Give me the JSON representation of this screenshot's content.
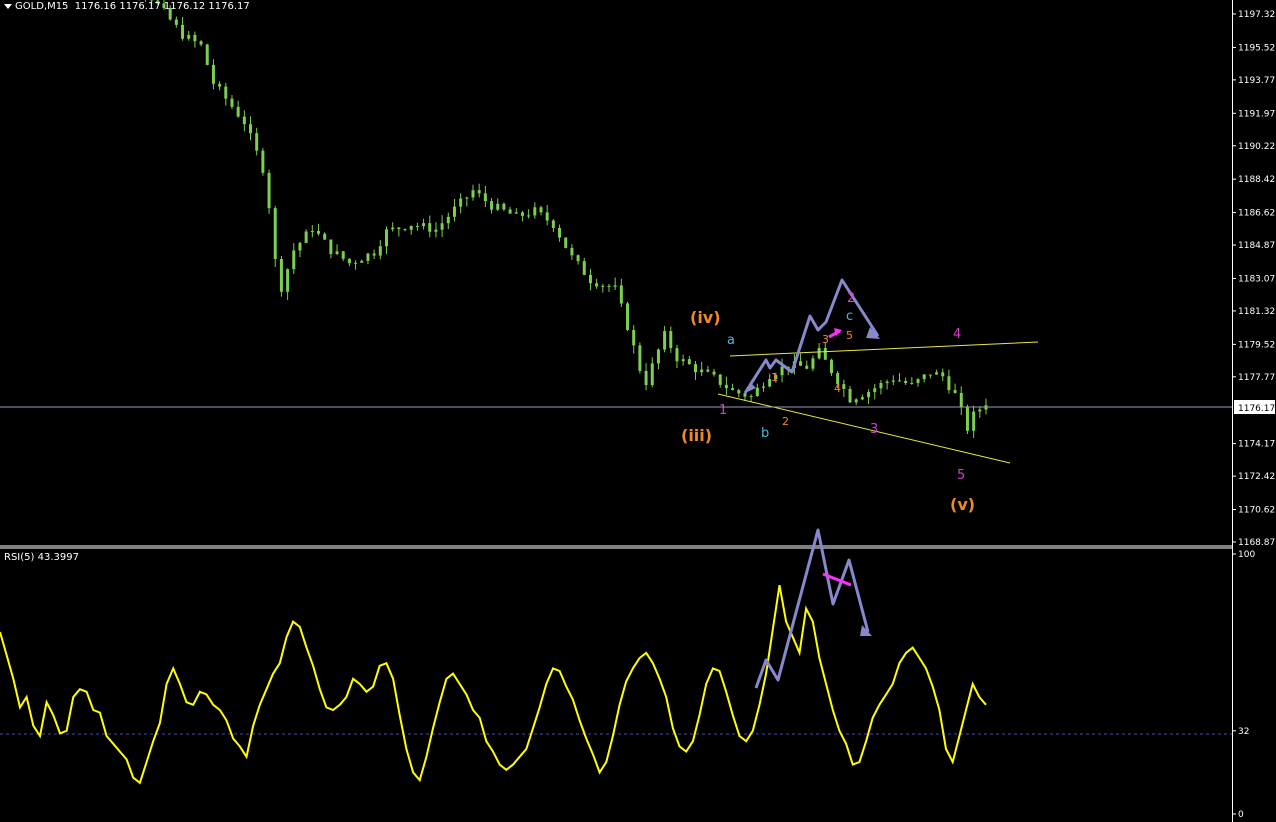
{
  "header": {
    "symbol": "GOLD,M15",
    "ohlc": "1176.16 1176.17 1176.12 1176.17"
  },
  "indicator": {
    "label": "RSI(5) 43.3997"
  },
  "colors": {
    "background": "#000000",
    "candle": "#7ccf50",
    "axis": "#ffffff",
    "rsi": "#ffff00",
    "rsi_level": "#4a4aaa",
    "trendline": "#e8e840",
    "arrow": "#8888cc",
    "wave_orange": "#f08a24",
    "wave_magenta": "#d040c8",
    "wave_cyan": "#4ab8e0",
    "wave_pink": "#ff30ff"
  },
  "chart_data": [
    {
      "type": "candlestick",
      "title": "GOLD,M15",
      "price_axis_ticks": [
        "1197.32",
        "1195.52",
        "1193.77",
        "1191.97",
        "1190.22",
        "1188.42",
        "1186.62",
        "1184.87",
        "1183.07",
        "1181.32",
        "1179.52",
        "1177.77",
        "1176.17",
        "1174.17",
        "1172.42",
        "1170.62",
        "1168.87"
      ],
      "current_price": "1176.17",
      "ylim": [
        1168.87,
        1197.32
      ],
      "trend_path_approx": [
        [
          0,
          1199.5
        ],
        [
          8,
          1198.6
        ],
        [
          14,
          1196.2
        ],
        [
          17,
          1195.6
        ],
        [
          19,
          1193.6
        ],
        [
          24,
          1191.5
        ],
        [
          27,
          1189.0
        ],
        [
          28,
          1187.0
        ],
        [
          29,
          1184.0
        ],
        [
          30,
          1182.6
        ],
        [
          32,
          1184.6
        ],
        [
          35,
          1185.8
        ],
        [
          38,
          1184.6
        ],
        [
          41,
          1183.9
        ],
        [
          45,
          1184.5
        ],
        [
          47,
          1185.6
        ],
        [
          51,
          1186.0
        ],
        [
          55,
          1185.7
        ],
        [
          58,
          1186.8
        ],
        [
          61,
          1187.8
        ],
        [
          64,
          1187.0
        ],
        [
          68,
          1186.4
        ],
        [
          71,
          1186.7
        ],
        [
          74,
          1186.0
        ],
        [
          77,
          1184.2
        ],
        [
          80,
          1183.0
        ],
        [
          84,
          1182.5
        ],
        [
          86,
          1180.5
        ],
        [
          88,
          1178.2
        ],
        [
          89,
          1177.5
        ],
        [
          91,
          1179.2
        ],
        [
          92,
          1180.0
        ],
        [
          94,
          1178.8
        ],
        [
          97,
          1178.2
        ],
        [
          100,
          1177.7
        ],
        [
          103,
          1177.0
        ],
        [
          106,
          1176.7
        ],
        [
          109,
          1177.9
        ],
        [
          112,
          1178.4
        ],
        [
          115,
          1178.3
        ],
        [
          117,
          1179.1
        ],
        [
          119,
          1178.1
        ],
        [
          122,
          1176.6
        ],
        [
          125,
          1177.0
        ],
        [
          129,
          1177.7
        ],
        [
          132,
          1177.3
        ],
        [
          135,
          1178.0
        ],
        [
          137,
          1177.8
        ],
        [
          139,
          1176.8
        ],
        [
          141,
          1175.0
        ],
        [
          142,
          1175.7
        ],
        [
          144,
          1176.4
        ]
      ],
      "annotations": [
        {
          "text": "(iii)",
          "color": "wave_orange"
        },
        {
          "text": "(iv)",
          "color": "wave_orange"
        },
        {
          "text": "(v)",
          "color": "wave_orange"
        },
        {
          "text": "a",
          "color": "wave_cyan"
        },
        {
          "text": "b",
          "color": "wave_cyan"
        },
        {
          "text": "c",
          "color": "wave_cyan"
        },
        {
          "text": "1",
          "color": "wave_magenta"
        },
        {
          "text": "2",
          "color": "wave_magenta"
        },
        {
          "text": "3",
          "color": "wave_magenta"
        },
        {
          "text": "4",
          "color": "wave_magenta"
        },
        {
          "text": "5",
          "color": "wave_magenta"
        },
        {
          "text": "1",
          "color": "wave_orange"
        },
        {
          "text": "2",
          "color": "wave_orange"
        },
        {
          "text": "3",
          "color": "wave_orange"
        },
        {
          "text": "4",
          "color": "wave_orange"
        },
        {
          "text": "5",
          "color": "wave_orange"
        }
      ]
    },
    {
      "type": "line",
      "title": "RSI(5) 43.3997",
      "ticks": [
        "100",
        "32",
        "0"
      ],
      "level": 32,
      "ylim": [
        0,
        100
      ],
      "series": [
        {
          "values": [
            70,
            61,
            52,
            41,
            45,
            34,
            30,
            43,
            38,
            31,
            32,
            45,
            48,
            47,
            40,
            39,
            30,
            27,
            24,
            21,
            14,
            12,
            20,
            28,
            35,
            50,
            56,
            50,
            43,
            42,
            47,
            46,
            42,
            40,
            36,
            29,
            26,
            22,
            34,
            42,
            48,
            54,
            58,
            68,
            74,
            72,
            64,
            57,
            48,
            41,
            40,
            42,
            45,
            52,
            50,
            47,
            49,
            57,
            58,
            52,
            38,
            25,
            16,
            13,
            22,
            33,
            43,
            52,
            54,
            50,
            46,
            40,
            37,
            28,
            24,
            19,
            17,
            19,
            22,
            25,
            33,
            41,
            50,
            56,
            55,
            49,
            44,
            36,
            29,
            23,
            16,
            20,
            30,
            42,
            51,
            56,
            60,
            62,
            58,
            52,
            45,
            33,
            26,
            24,
            28,
            38,
            50,
            56,
            55,
            47,
            38,
            30,
            28,
            32,
            42,
            54,
            71,
            88,
            74,
            68,
            62,
            79,
            74,
            60,
            50,
            40,
            32,
            27,
            19,
            20,
            28,
            37,
            42,
            46,
            50,
            58,
            62,
            64,
            60,
            56,
            49,
            40,
            25,
            20,
            30,
            40,
            50,
            45,
            42
          ]
        }
      ]
    }
  ]
}
